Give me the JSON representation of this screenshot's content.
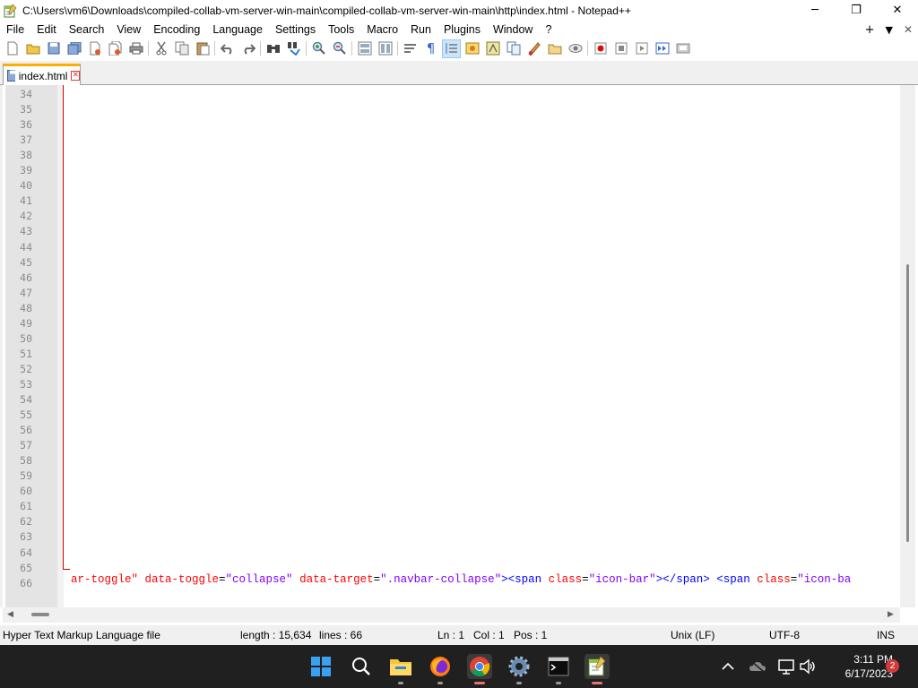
{
  "window": {
    "title": "C:\\Users\\vm6\\Downloads\\compiled-collab-vm-server-win-main\\compiled-collab-vm-server-win-main\\http\\index.html - Notepad++",
    "minimize_glyph": "─",
    "restore_glyph": "❐",
    "close_glyph": "✕"
  },
  "menu": {
    "items": [
      "File",
      "Edit",
      "Search",
      "View",
      "Encoding",
      "Language",
      "Settings",
      "Tools",
      "Macro",
      "Run",
      "Plugins",
      "Window",
      "?"
    ],
    "right": {
      "add_glyph": "+",
      "dropdown_glyph": "▼",
      "close_glyph": "✕"
    }
  },
  "toolbar": {
    "icons": [
      "new-file",
      "open-file",
      "save",
      "save-all",
      "close",
      "close-all",
      "print",
      "cut",
      "copy",
      "paste",
      "undo",
      "redo",
      "find",
      "replace",
      "zoom-in",
      "zoom-out",
      "sync-vertical",
      "sync-horizontal",
      "word-wrap",
      "show-all-chars",
      "indent-guide",
      "user-defined-language",
      "document-map",
      "function-list",
      "folder-as-workspace",
      "doc-list",
      "monitoring",
      "record-macro",
      "stop-record",
      "play-macro",
      "run-macro-multiple",
      "save-macro"
    ]
  },
  "tabs": [
    {
      "label": "index.html",
      "close_glyph": "✕"
    }
  ],
  "editor": {
    "line_numbers": [
      "34",
      "35",
      "36",
      "37",
      "38",
      "39",
      "40",
      "41",
      "42",
      "43",
      "44",
      "45",
      "46",
      "47",
      "48",
      "49",
      "50",
      "51",
      "52",
      "53",
      "54",
      "55",
      "56",
      "57",
      "58",
      "59",
      "60",
      "61",
      "62",
      "63",
      "64",
      "65",
      "66"
    ],
    "code_line": {
      "t1": "ar-toggle\"",
      "t2": " data-toggle",
      "t3": "=",
      "t4": "\"collapse\"",
      "t5": " data-target",
      "t6": "=",
      "t7": "\".navbar-collapse\"",
      "t8": "><span",
      "t9": " class",
      "t10": "=",
      "t11": "\"icon-bar\"",
      "t12": "></span>",
      "t13": " <span",
      "t14": " class",
      "t15": "=",
      "t16": "\"icon-ba"
    }
  },
  "status": {
    "file_type": "Hyper Text Markup Language file",
    "length": "length : 15,634",
    "lines": "lines : 66",
    "ln": "Ln : 1",
    "col": "Col : 1",
    "pos": "Pos : 1",
    "eol": "Unix (LF)",
    "encoding": "UTF-8",
    "mode": "INS"
  },
  "taskbar": {
    "apps": [
      "start",
      "search",
      "file-explorer",
      "firefox",
      "chrome",
      "settings",
      "terminal",
      "notepad-plus-plus"
    ],
    "clock_time": "3:11 PM",
    "clock_date": "6/17/2023",
    "notification_count": "2"
  }
}
